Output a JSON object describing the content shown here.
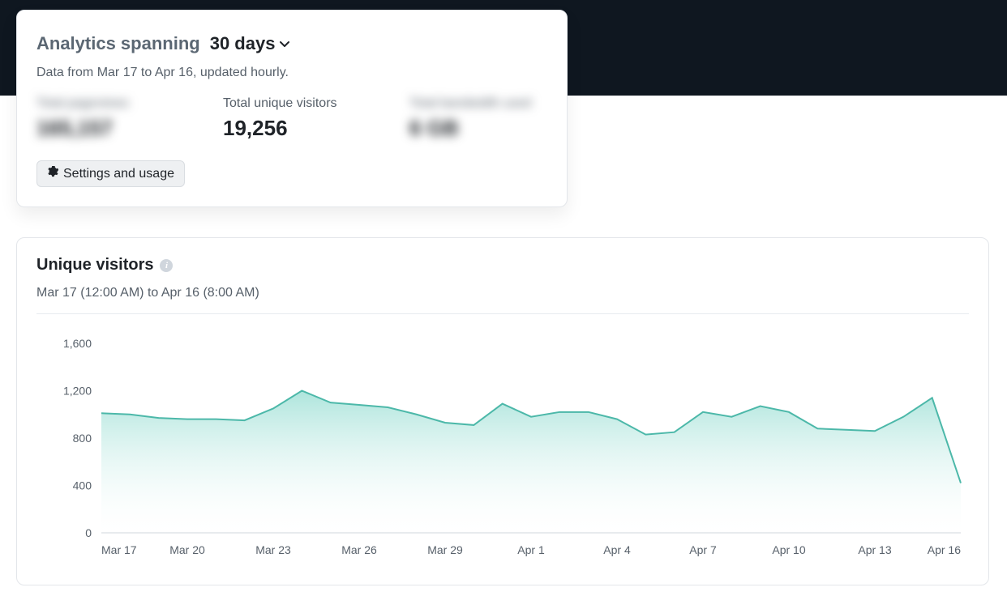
{
  "header": {
    "label": "Analytics spanning",
    "range": "30 days",
    "subtext": "Data from Mar 17 to Apr 16, updated hourly."
  },
  "stats": [
    {
      "label": "Total pageviews",
      "value": "165,157",
      "blurred": true
    },
    {
      "label": "Total unique visitors",
      "value": "19,256",
      "blurred": false
    },
    {
      "label": "Total bandwidth used",
      "value": "6 GB",
      "blurred": true
    }
  ],
  "settings_button": "Settings and usage",
  "chart": {
    "title": "Unique visitors",
    "subtext": "Mar 17 (12:00 AM) to Apr 16 (8:00 AM)"
  },
  "chart_data": {
    "type": "area",
    "title": "Unique visitors",
    "xlabel": "",
    "ylabel": "",
    "ylim": [
      0,
      1600
    ],
    "y_ticks": [
      0,
      400,
      800,
      1200,
      1600
    ],
    "x_ticks": [
      "Mar 17",
      "Mar 20",
      "Mar 23",
      "Mar 26",
      "Mar 29",
      "Apr 1",
      "Apr 4",
      "Apr 7",
      "Apr 10",
      "Apr 13",
      "Apr 16"
    ],
    "categories": [
      "Mar 17",
      "Mar 18",
      "Mar 19",
      "Mar 20",
      "Mar 21",
      "Mar 22",
      "Mar 23",
      "Mar 24",
      "Mar 25",
      "Mar 26",
      "Mar 27",
      "Mar 28",
      "Mar 29",
      "Mar 30",
      "Mar 31",
      "Apr 1",
      "Apr 2",
      "Apr 3",
      "Apr 4",
      "Apr 5",
      "Apr 6",
      "Apr 7",
      "Apr 8",
      "Apr 9",
      "Apr 10",
      "Apr 11",
      "Apr 12",
      "Apr 13",
      "Apr 14",
      "Apr 15",
      "Apr 16"
    ],
    "values": [
      1010,
      1000,
      970,
      960,
      960,
      950,
      1050,
      1200,
      1100,
      1080,
      1060,
      1000,
      930,
      910,
      1090,
      980,
      1020,
      1020,
      960,
      830,
      850,
      1020,
      980,
      1070,
      1020,
      880,
      870,
      860,
      980,
      1140,
      420
    ]
  }
}
